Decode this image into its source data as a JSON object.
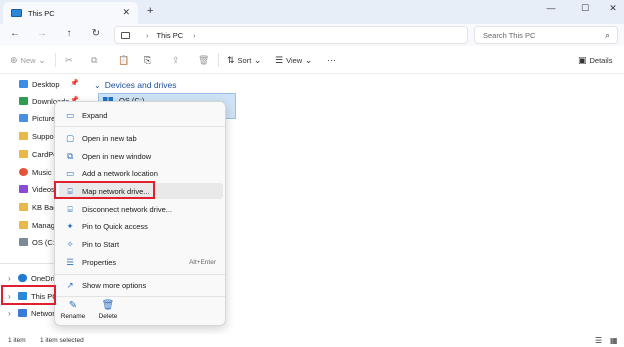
{
  "tab": {
    "title": "This PC",
    "close": "✕",
    "add": "+"
  },
  "window_controls": {
    "minimize": "—",
    "maximize": "☐",
    "close": "✕"
  },
  "nav": {
    "back": "←",
    "forward": "→",
    "up": "↑",
    "refresh": "↻",
    "address_root": "›",
    "address_label": "This PC",
    "address_chevron": "›",
    "search_placeholder": "Search This PC",
    "search_icon": "⌕"
  },
  "toolbar": {
    "new_label": "New",
    "new_chevron": "⌄",
    "sort_label": "Sort",
    "sort_chevron": "⌄",
    "view_label": "View",
    "view_chevron": "⌄",
    "more": "···",
    "details_label": "Details"
  },
  "sidebar": {
    "pinned": [
      {
        "label": "Desktop",
        "color": "#3a8ee6",
        "pin": "📌"
      },
      {
        "label": "Downloads",
        "color": "#2e9d4f",
        "pin": "📌"
      },
      {
        "label": "Pictures",
        "color": "#4a90e2",
        "pin": ""
      },
      {
        "label": "Support",
        "color": "#e8b84a",
        "pin": ""
      },
      {
        "label": "CardPo",
        "color": "#e8b84a",
        "pin": ""
      },
      {
        "label": "Music",
        "color": "#e3543b",
        "pin": ""
      },
      {
        "label": "Videos",
        "color": "#8b4bd8",
        "pin": ""
      },
      {
        "label": "KB Back",
        "color": "#e8b84a",
        "pin": ""
      },
      {
        "label": "Manag",
        "color": "#e8b84a",
        "pin": ""
      },
      {
        "label": "OS (C:)",
        "color": "#7a8a99",
        "pin": ""
      }
    ],
    "tree": [
      {
        "chevron": "›",
        "label": "OneDriv",
        "color": "#1f7ad1"
      },
      {
        "chevron": "›",
        "label": "This PC",
        "color": "#2b88d8"
      },
      {
        "chevron": "›",
        "label": "Network",
        "color": "#3a7bd5"
      }
    ]
  },
  "content": {
    "section_chevron": "⌄",
    "section_title": "Devices and drives",
    "drive_label": "OS (C:)"
  },
  "context_menu": {
    "items": [
      {
        "icon": "▭",
        "label": "Expand",
        "shortcut": ""
      },
      {
        "icon": "▢",
        "label": "Open in new tab",
        "shortcut": ""
      },
      {
        "icon": "⧉",
        "label": "Open in new window",
        "shortcut": ""
      },
      {
        "icon": "▭",
        "label": "Add a network location",
        "shortcut": ""
      },
      {
        "icon": "⌸",
        "label": "Map network drive...",
        "shortcut": ""
      },
      {
        "icon": "⌸",
        "label": "Disconnect network drive...",
        "shortcut": ""
      },
      {
        "icon": "✦",
        "label": "Pin to Quick access",
        "shortcut": ""
      },
      {
        "icon": "✧",
        "label": "Pin to Start",
        "shortcut": ""
      },
      {
        "icon": "☰",
        "label": "Properties",
        "shortcut": "Alt+Enter"
      },
      {
        "icon": "↗",
        "label": "Show more options",
        "shortcut": ""
      }
    ],
    "bottom": [
      {
        "icon": "✎",
        "label": "Rename"
      },
      {
        "icon": "🗑",
        "label": "Delete"
      }
    ]
  },
  "status": {
    "count": "1 item",
    "selected": "1 item selected",
    "details_view": "☰",
    "tiles_view": "▦"
  },
  "colors": {
    "annotation": "#e0202e",
    "accent": "#2b6fbf",
    "selection": "#cfe3f7"
  }
}
